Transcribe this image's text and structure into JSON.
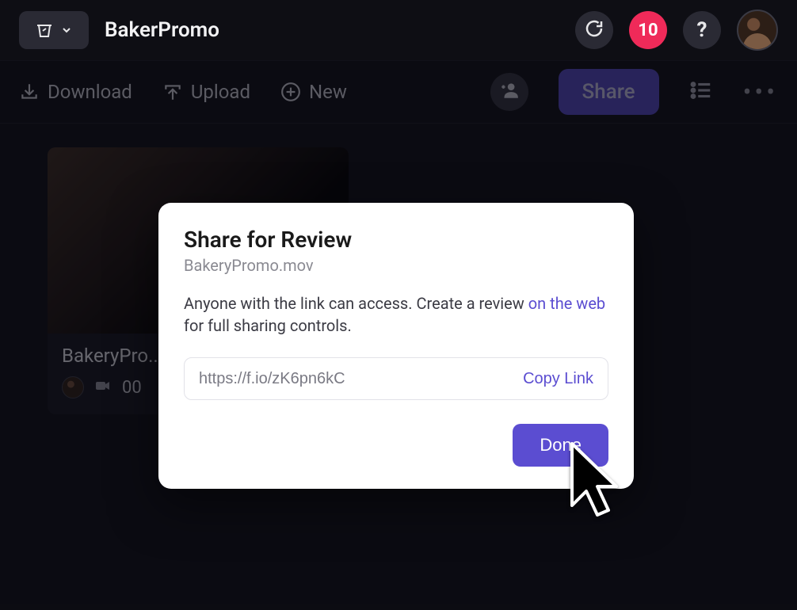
{
  "header": {
    "project_name": "BakerPromo",
    "notification_count": "10"
  },
  "toolbar": {
    "download_label": "Download",
    "upload_label": "Upload",
    "new_label": "New",
    "share_label": "Share"
  },
  "asset": {
    "title_truncated": "BakeryPro...",
    "duration_truncated": "00"
  },
  "modal": {
    "title": "Share for Review",
    "filename": "BakeryPromo.mov",
    "desc_part1": "Anyone with the link can access. Create a review ",
    "desc_link_text": "on the web",
    "desc_part2": " for full sharing controls.",
    "share_url": "https://f.io/zK6pn6kC",
    "copy_label": "Copy Link",
    "done_label": "Done"
  },
  "colors": {
    "accent": "#5b4dd1",
    "danger": "#ef2a59",
    "bg": "#0e0e14"
  }
}
